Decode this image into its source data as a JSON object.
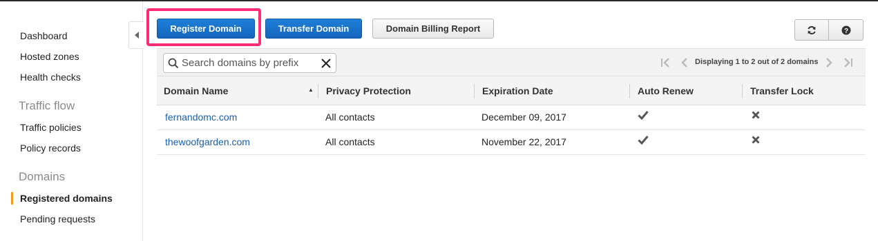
{
  "sidebar": {
    "items": [
      {
        "label": "Dashboard"
      },
      {
        "label": "Hosted zones"
      },
      {
        "label": "Health checks"
      }
    ],
    "traffic_flow": {
      "title": "Traffic flow",
      "items": [
        {
          "label": "Traffic policies"
        },
        {
          "label": "Policy records"
        }
      ]
    },
    "domains": {
      "title": "Domains",
      "items": [
        {
          "label": "Registered domains",
          "active": true
        },
        {
          "label": "Pending requests"
        }
      ]
    },
    "collapse_icon": "triangle-left-icon"
  },
  "toolbar": {
    "register_label": "Register Domain",
    "transfer_label": "Transfer Domain",
    "billing_label": "Domain Billing Report",
    "refresh_icon": "refresh-icon",
    "help_icon": "help-icon"
  },
  "search": {
    "placeholder": "Search domains by prefix",
    "value": ""
  },
  "pager": {
    "text": "Displaying 1 to 2 out of 2 domains"
  },
  "table": {
    "columns": [
      "Domain Name",
      "Privacy Protection",
      "Expiration Date",
      "Auto Renew",
      "Transfer Lock"
    ],
    "sort_indicator": "▲",
    "rows": [
      {
        "domain": "fernandomc.com",
        "privacy": "All contacts",
        "expiration": "December 09, 2017",
        "auto_renew": true,
        "transfer_lock": false
      },
      {
        "domain": "thewoofgarden.com",
        "privacy": "All contacts",
        "expiration": "November 22, 2017",
        "auto_renew": true,
        "transfer_lock": false
      }
    ]
  },
  "colors": {
    "primary": "#1565bd",
    "highlight": "#ff2d78",
    "active_marker": "#f29a1f",
    "link": "#1a5fb4"
  }
}
